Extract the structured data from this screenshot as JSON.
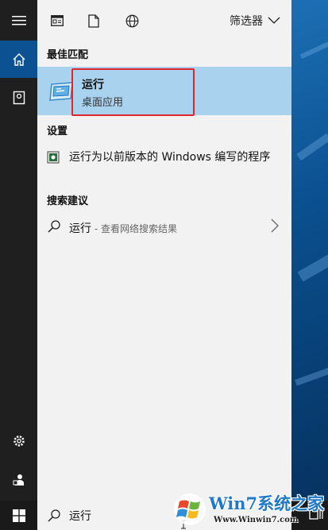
{
  "toolbar": {
    "filter_label": "筛选器"
  },
  "sections": {
    "best_match": "最佳匹配",
    "settings": "设置",
    "search_suggestions": "搜索建议"
  },
  "best_match": {
    "name": "运行",
    "subtitle": "桌面应用"
  },
  "settings_item": {
    "label": "运行为以前版本的 Windows 编写的程序"
  },
  "suggestion": {
    "query": "运行",
    "hint": " - 查看网络搜索结果"
  },
  "search_box": {
    "value": "运行"
  },
  "watermark": {
    "brand": "Win7系统之家",
    "url": "Www.Winwin7.com"
  },
  "colors": {
    "rail": "#1f1f1f",
    "active_rail": "#0c5191",
    "highlight": "#a9d2ef",
    "red_box": "#e0262b",
    "panel": "#f2f2f2"
  },
  "icons": {
    "rail": [
      "hamburger-icon",
      "home-icon",
      "notebook-icon",
      "gear-icon",
      "feedback-icon"
    ],
    "toolbar": [
      "document-list-icon",
      "file-icon",
      "globe-icon"
    ],
    "taskbar": [
      "windows-start-icon",
      "search-icon",
      "task-view-icon"
    ]
  }
}
